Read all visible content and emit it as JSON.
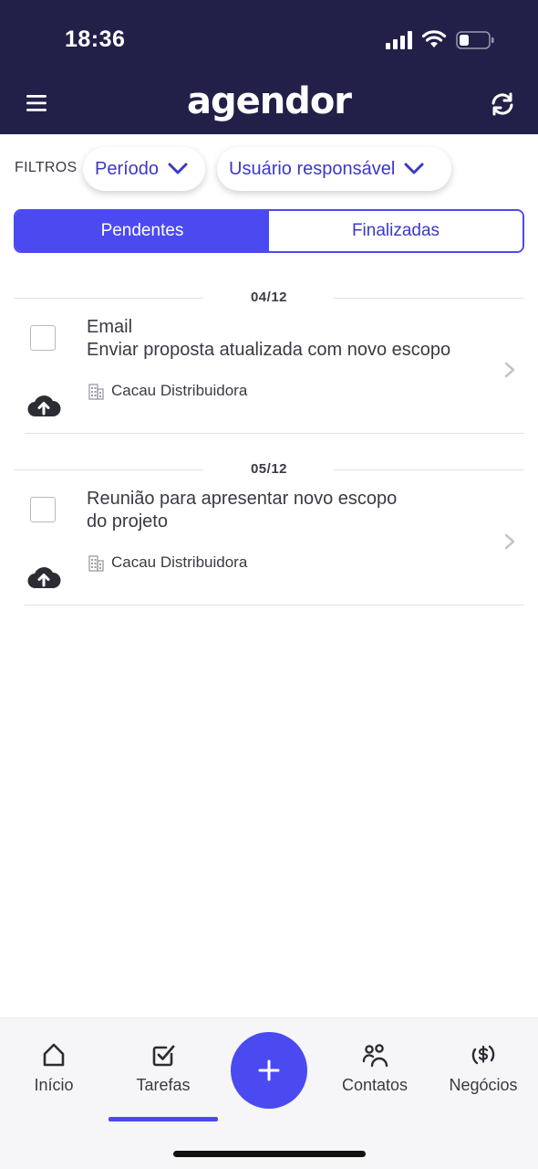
{
  "status_bar": {
    "time": "18:36"
  },
  "header": {
    "logo": "agendor"
  },
  "filters": {
    "label": "FILTROS",
    "periodo": "Período",
    "usuario": "Usuário responsável"
  },
  "segments": {
    "pending": "Pendentes",
    "done": "Finalizadas"
  },
  "groups": [
    {
      "date": "04/12",
      "task": {
        "line1": "Email",
        "line2": "Enviar proposta atualizada com novo escopo",
        "company": "Cacau Distribuidora"
      }
    },
    {
      "date": "05/12",
      "task": {
        "line1": "Reunião para apresentar novo escopo",
        "line2": "do projeto",
        "company": "Cacau Distribuidora"
      }
    }
  ],
  "tabbar": {
    "inicio": "Início",
    "tarefas": "Tarefas",
    "contatos": "Contatos",
    "negocios": "Negócios"
  },
  "colors": {
    "header_bg": "#222049",
    "accent": "#4b4af0",
    "accent_text": "#3d38c5"
  }
}
